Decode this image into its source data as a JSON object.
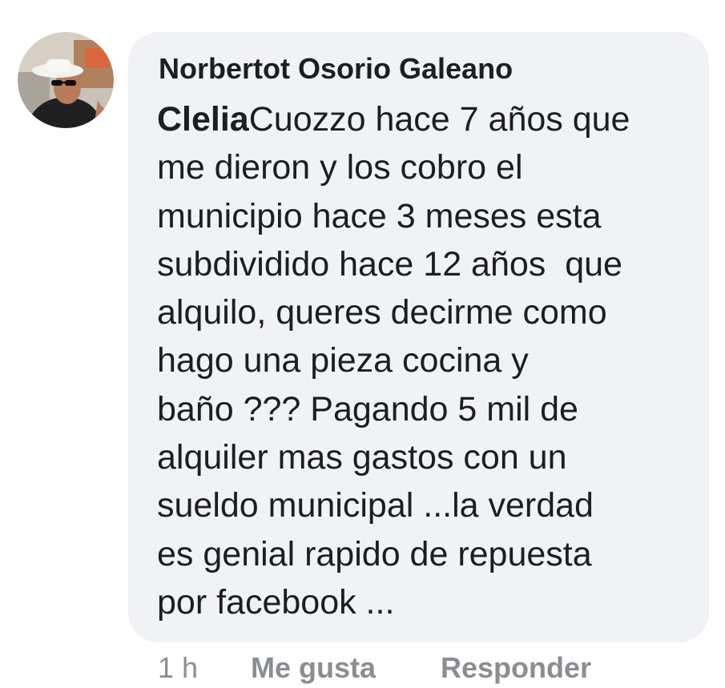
{
  "comment": {
    "author_name": "Norbertot Osorio Galeano",
    "mention": "Clelia",
    "text_lines": [
      "Cuozzo hace 7 años que",
      "me dieron y los cobro el",
      "municipio hace 3 meses esta",
      "subdividido hace 12 años  que",
      "alquilo, queres decirme como",
      "hago una pieza cocina y",
      "baño ??? Pagando 5 mil de",
      "alquiler mas gastos con un",
      "sueldo municipal ...la verdad",
      "es genial rapido de repuesta",
      "por facebook ..."
    ]
  },
  "actions": {
    "time": "1 h",
    "like_label": "Me gusta",
    "reply_label": "Responder"
  },
  "colors": {
    "bubble_background": "#f0f2f5",
    "text_primary": "#1c1e21",
    "text_secondary": "#8a8d91"
  }
}
